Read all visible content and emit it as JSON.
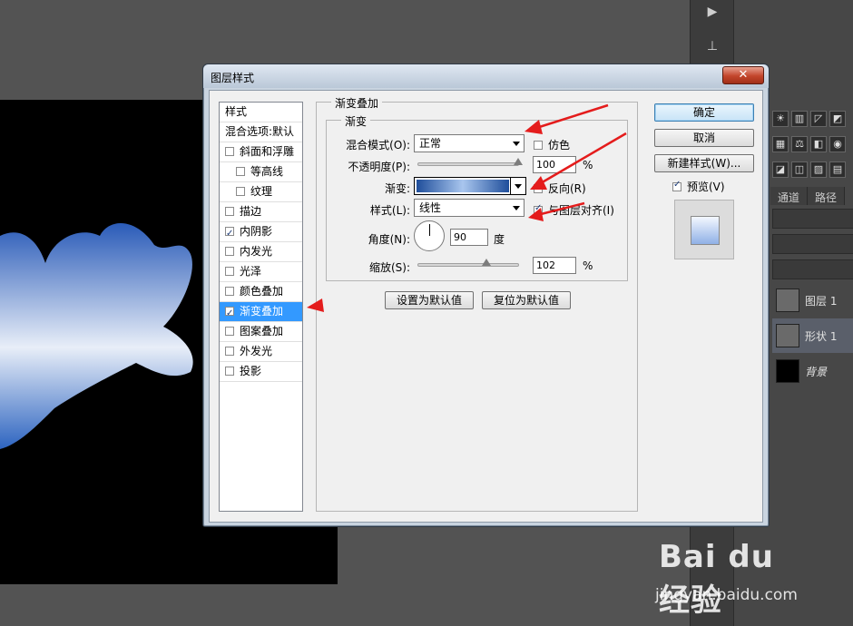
{
  "dialog": {
    "title": "图层样式",
    "close_label": "✕"
  },
  "left_list": {
    "items": [
      {
        "label": "样式",
        "checkbox": false,
        "checked": false
      },
      {
        "label": "混合选项:默认",
        "checkbox": false,
        "checked": false
      },
      {
        "label": "斜面和浮雕",
        "checkbox": true,
        "checked": false
      },
      {
        "label": "等高线",
        "checkbox": true,
        "checked": false
      },
      {
        "label": "纹理",
        "checkbox": true,
        "checked": false
      },
      {
        "label": "描边",
        "checkbox": true,
        "checked": false
      },
      {
        "label": "内阴影",
        "checkbox": true,
        "checked": true
      },
      {
        "label": "内发光",
        "checkbox": true,
        "checked": false
      },
      {
        "label": "光泽",
        "checkbox": true,
        "checked": false
      },
      {
        "label": "颜色叠加",
        "checkbox": true,
        "checked": false
      },
      {
        "label": "渐变叠加",
        "checkbox": true,
        "checked": true,
        "selected": true
      },
      {
        "label": "图案叠加",
        "checkbox": true,
        "checked": false
      },
      {
        "label": "外发光",
        "checkbox": true,
        "checked": false
      },
      {
        "label": "投影",
        "checkbox": true,
        "checked": false
      }
    ]
  },
  "gradient_overlay": {
    "section_title": "渐变叠加",
    "group_title": "渐变",
    "blend_mode_label": "混合模式(O):",
    "blend_mode_value": "正常",
    "dither_label": "仿色",
    "dither_checked": false,
    "opacity_label": "不透明度(P):",
    "opacity_value": "100",
    "opacity_unit": "%",
    "opacity_level": 1.0,
    "gradient_label": "渐变:",
    "reverse_label": "反向(R)",
    "reverse_checked": false,
    "style_label": "样式(L):",
    "style_value": "线性",
    "align_label": "与图层对齐(I)",
    "align_checked": true,
    "angle_label": "角度(N):",
    "angle_value": "90",
    "angle_unit": "度",
    "scale_label": "缩放(S):",
    "scale_value": "102",
    "scale_unit": "%",
    "scale_level": 0.68,
    "set_default_label": "设置为默认值",
    "reset_default_label": "复位为默认值"
  },
  "actions": {
    "ok_label": "确定",
    "cancel_label": "取消",
    "new_style_label": "新建样式(W)...",
    "preview_label": "预览(V)",
    "preview_checked": true
  },
  "right_panel": {
    "tab_channels": "通道",
    "tab_paths": "路径",
    "layers": [
      {
        "name": "图层 1"
      },
      {
        "name": "形状 1"
      },
      {
        "name": "背景"
      }
    ]
  },
  "watermark": {
    "logo": "Bai du 经验",
    "url": "jingyan.baidu.com"
  },
  "colors": {
    "selection": "#3399ff",
    "annotation_red": "#e41c1c",
    "dove_blue": "#3a6fc7"
  }
}
